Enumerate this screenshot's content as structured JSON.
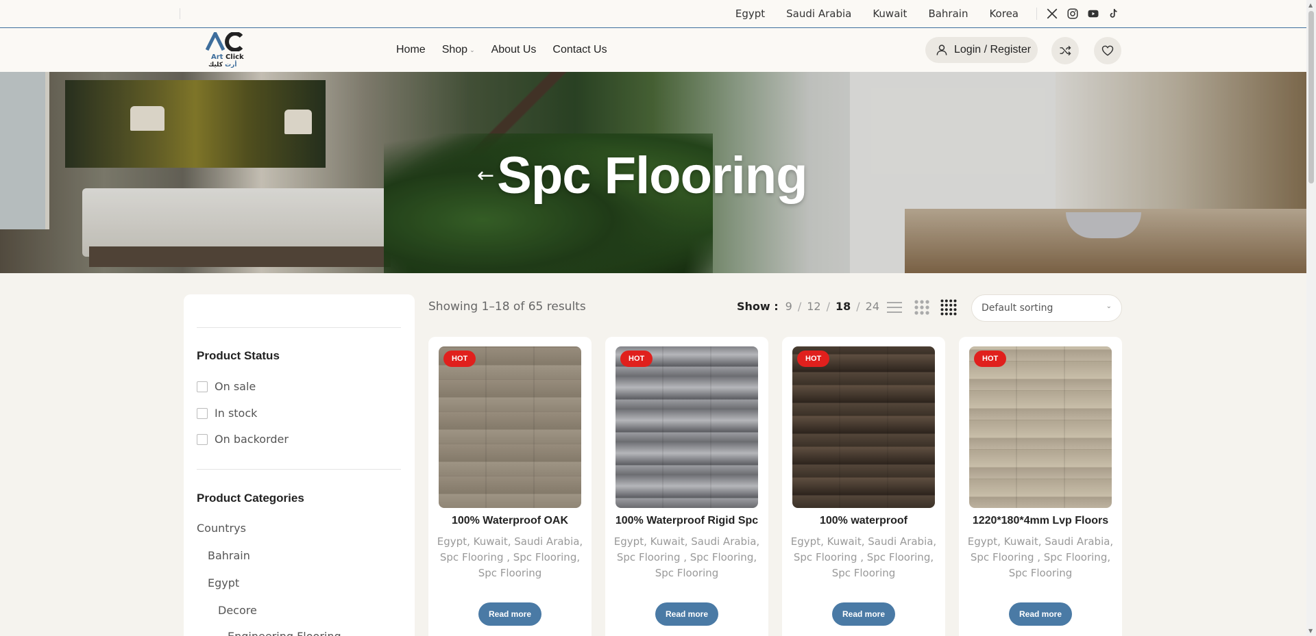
{
  "topbar": {
    "countries": [
      "Egypt",
      "Saudi Arabia",
      "Kuwait",
      "Bahrain",
      "Korea"
    ],
    "social_icons": [
      "x-icon",
      "instagram-icon",
      "youtube-icon",
      "tiktok-icon"
    ]
  },
  "logo": {
    "mark": "AC",
    "name_part1": "Art",
    "name_part2": "Click",
    "arabic_part1": "أرت",
    "arabic_part2": "كليك"
  },
  "nav": {
    "items": [
      "Home",
      "Shop",
      "About Us",
      "Contact Us"
    ]
  },
  "header": {
    "login_label": "Login / Register"
  },
  "hero": {
    "back_arrow": "←",
    "title": "Spc Flooring"
  },
  "sidebar": {
    "status_title": "Product Status",
    "status_options": [
      "On sale",
      "In stock",
      "On backorder"
    ],
    "categories_title": "Product Categories",
    "categories": [
      "Countrys",
      "Bahrain",
      "Egypt",
      "Decore",
      "Engineering Flooring"
    ]
  },
  "toolbar": {
    "results_text": "Showing 1–18 of 65 results",
    "show_label": "Show :",
    "per_page": [
      "9",
      "12",
      "18",
      "24"
    ],
    "per_page_selected": "18",
    "sort_label": "Default sorting"
  },
  "products": [
    {
      "badge": "HOT",
      "title": "100% Waterproof OAK",
      "cats": "Egypt, Kuwait, Saudi Arabia, Spc Flooring , Spc Flooring, Spc Flooring",
      "button": "Read more"
    },
    {
      "badge": "HOT",
      "title": "100% Waterproof Rigid Spc",
      "cats": "Egypt, Kuwait, Saudi Arabia, Spc Flooring , Spc Flooring, Spc Flooring",
      "button": "Read more"
    },
    {
      "badge": "HOT",
      "title": "100% waterproof",
      "cats": "Egypt, Kuwait, Saudi Arabia, Spc Flooring , Spc Flooring, Spc Flooring",
      "button": "Read more"
    },
    {
      "badge": "HOT",
      "title": "1220*180*4mm Lvp Floors",
      "cats": "Egypt, Kuwait, Saudi Arabia, Spc Flooring , Spc Flooring, Spc Flooring",
      "button": "Read more"
    }
  ],
  "colors": {
    "accent": "#4a7aa5",
    "badge": "#e0201d",
    "topbar_border": "#3e6e9c"
  }
}
